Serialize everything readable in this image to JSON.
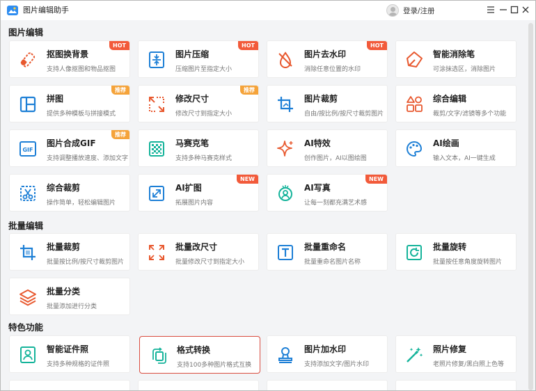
{
  "app": {
    "title": "图片编辑助手",
    "login_label": "登录/注册"
  },
  "colors": {
    "accent": "#1d7fd6",
    "hot_badge": "#f25a3a",
    "recommend_badge": "#f5a33a",
    "selected_border": "#d94b3e"
  },
  "sections": {
    "edit": {
      "title": "图片编辑",
      "cards": [
        {
          "name": "抠图换背景",
          "desc": "支持人像抠图和物品抠图",
          "badge": "HOT",
          "icon": "eraser-cut-icon"
        },
        {
          "name": "图片压缩",
          "desc": "压缩图片至指定大小",
          "badge": "HOT",
          "icon": "compress-icon"
        },
        {
          "name": "图片去水印",
          "desc": "消除任意位置的水印",
          "badge": "HOT",
          "icon": "watermark-remove-icon"
        },
        {
          "name": "智能消除笔",
          "desc": "可涂抹选区，消除图片",
          "badge": "",
          "icon": "smart-eraser-icon"
        },
        {
          "name": "拼图",
          "desc": "提供多种模板与拼接模式",
          "badge": "推荐",
          "icon": "collage-icon"
        },
        {
          "name": "修改尺寸",
          "desc": "修改尺寸到指定大小",
          "badge": "推荐",
          "icon": "resize-icon"
        },
        {
          "name": "图片裁剪",
          "desc": "自由/按比例/按尺寸裁剪图片",
          "badge": "",
          "icon": "crop-icon"
        },
        {
          "name": "综合编辑",
          "desc": "裁剪/文字/滤镜等多个功能",
          "badge": "",
          "icon": "shapes-icon"
        },
        {
          "name": "图片合成GIF",
          "desc": "支持调整播放速度、添加文字",
          "badge": "推荐",
          "icon": "gif-icon"
        },
        {
          "name": "马赛克笔",
          "desc": "支持多种马赛克样式",
          "badge": "",
          "icon": "mosaic-icon"
        },
        {
          "name": "AI特效",
          "desc": "创作图片，AI以图绘图",
          "badge": "",
          "icon": "sparkle-icon"
        },
        {
          "name": "AI绘画",
          "desc": "输入文本，AI一键生成",
          "badge": "",
          "icon": "palette-icon"
        },
        {
          "name": "综合裁剪",
          "desc": "操作简单，轻松编辑图片",
          "badge": "",
          "icon": "scissors-icon"
        },
        {
          "name": "AI扩图",
          "desc": "拓展图片内容",
          "badge": "NEW",
          "icon": "expand-icon"
        },
        {
          "name": "AI写真",
          "desc": "让每一刻都充满艺术感",
          "badge": "NEW",
          "icon": "portrait-icon"
        }
      ]
    },
    "batch": {
      "title": "批量编辑",
      "cards": [
        {
          "name": "批量裁剪",
          "desc": "批量按比例/按尺寸裁剪图片",
          "badge": "",
          "icon": "batch-crop-icon"
        },
        {
          "name": "批量改尺寸",
          "desc": "批量修改尺寸到指定大小",
          "badge": "",
          "icon": "batch-resize-icon"
        },
        {
          "name": "批量重命名",
          "desc": "批量重命名图片名称",
          "badge": "",
          "icon": "rename-icon"
        },
        {
          "name": "批量旋转",
          "desc": "批量按任意角度旋转图片",
          "badge": "",
          "icon": "rotate-icon"
        },
        {
          "name": "批量分类",
          "desc": "批量添加进行分类",
          "badge": "",
          "icon": "layers-icon"
        }
      ]
    },
    "feature": {
      "title": "特色功能",
      "cards": [
        {
          "name": "智能证件照",
          "desc": "支持多种规格的证件照",
          "badge": "",
          "icon": "id-photo-icon"
        },
        {
          "name": "格式转换",
          "desc": "支持100多种图片格式互换",
          "badge": "",
          "icon": "convert-icon"
        },
        {
          "name": "图片加水印",
          "desc": "支持添加文字/图片水印",
          "badge": "",
          "icon": "add-watermark-icon"
        },
        {
          "name": "照片修复",
          "desc": "老照片修复/黑白照上色等",
          "badge": "",
          "icon": "magic-wand-icon"
        }
      ]
    }
  }
}
